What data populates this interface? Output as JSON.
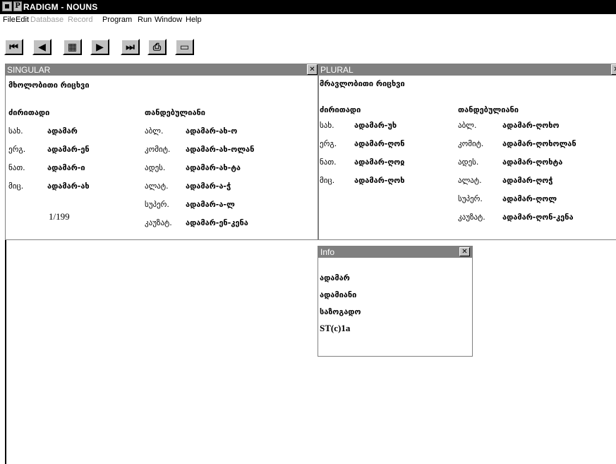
{
  "app": {
    "title": "RADIGM - NOUNS"
  },
  "menu": [
    "File",
    "Edit",
    "Database",
    "Record",
    "Program",
    "Run",
    "Window",
    "Help"
  ],
  "toolbar": {
    "buttons": [
      {
        "name": "first-record-icon",
        "glyph": "⏮"
      },
      {
        "name": "previous-record-icon",
        "glyph": "◀"
      },
      {
        "name": "find-icon",
        "glyph": "▦"
      },
      {
        "name": "next-record-icon",
        "glyph": "▶"
      },
      {
        "name": "last-record-icon",
        "glyph": "⏭"
      },
      {
        "name": "print-icon",
        "glyph": "⎙"
      },
      {
        "name": "open-window-icon",
        "glyph": "▭"
      }
    ]
  },
  "singular": {
    "title": "SINGULAR",
    "heading": "მხოლობითი რიცხვი",
    "basic_header": "ძირითადი",
    "post_header": "თანდებულიანი",
    "basic_rows": [
      {
        "label": "სახ.",
        "value": "ადამარ"
      },
      {
        "label": "ერგ.",
        "value": "ადამარ-ენ"
      },
      {
        "label": "ნათ.",
        "value": "ადამარ-ი"
      },
      {
        "label": "მიც.",
        "value": "ადამარ-ახ"
      }
    ],
    "post_rows": [
      {
        "label": "აბლ.",
        "value": "ადამარ-ახ-ო"
      },
      {
        "label": "კომიტ.",
        "value": "ადამარ-ახ-ოლან"
      },
      {
        "label": "ადეს.",
        "value": "ადამარ-ახ-ტა"
      },
      {
        "label": "ალატ.",
        "value": "ადამარ-ა-ჭ"
      },
      {
        "label": "სუპერ.",
        "value": "ადამარ-ა-ლ"
      },
      {
        "label": "კაუზატ.",
        "value": "ადამარ-ენ-კენა"
      }
    ],
    "page": "1/199"
  },
  "plural": {
    "title": "PLURAL",
    "heading": "მრავლობითი რიცხვი",
    "basic_header": "ძირითადი",
    "post_header": "თანდებულიანი",
    "basic_rows": [
      {
        "label": "სახ.",
        "value": "ადამარ-უხ"
      },
      {
        "label": "ერგ.",
        "value": "ადამარ-ღონ"
      },
      {
        "label": "ნათ.",
        "value": "ადამარ-ღოჲ"
      },
      {
        "label": "მიც.",
        "value": "ადამარ-ღოხ"
      }
    ],
    "post_rows": [
      {
        "label": "აბლ.",
        "value": "ადამარ-ღოხო"
      },
      {
        "label": "კომიტ.",
        "value": "ადამარ-ღოხოლან"
      },
      {
        "label": "ადეს.",
        "value": "ადამარ-ღოხტა"
      },
      {
        "label": "ალატ.",
        "value": "ადამარ-ღოჭ"
      },
      {
        "label": "სუპერ.",
        "value": "ადამარ-ღოლ"
      },
      {
        "label": "კაუზატ.",
        "value": "ადამარ-ღონ-კენა"
      }
    ]
  },
  "info": {
    "title": "Info",
    "lines": [
      "ადამარ",
      "ადამიანი",
      "საზოგადო",
      "ST(c)1a"
    ]
  }
}
